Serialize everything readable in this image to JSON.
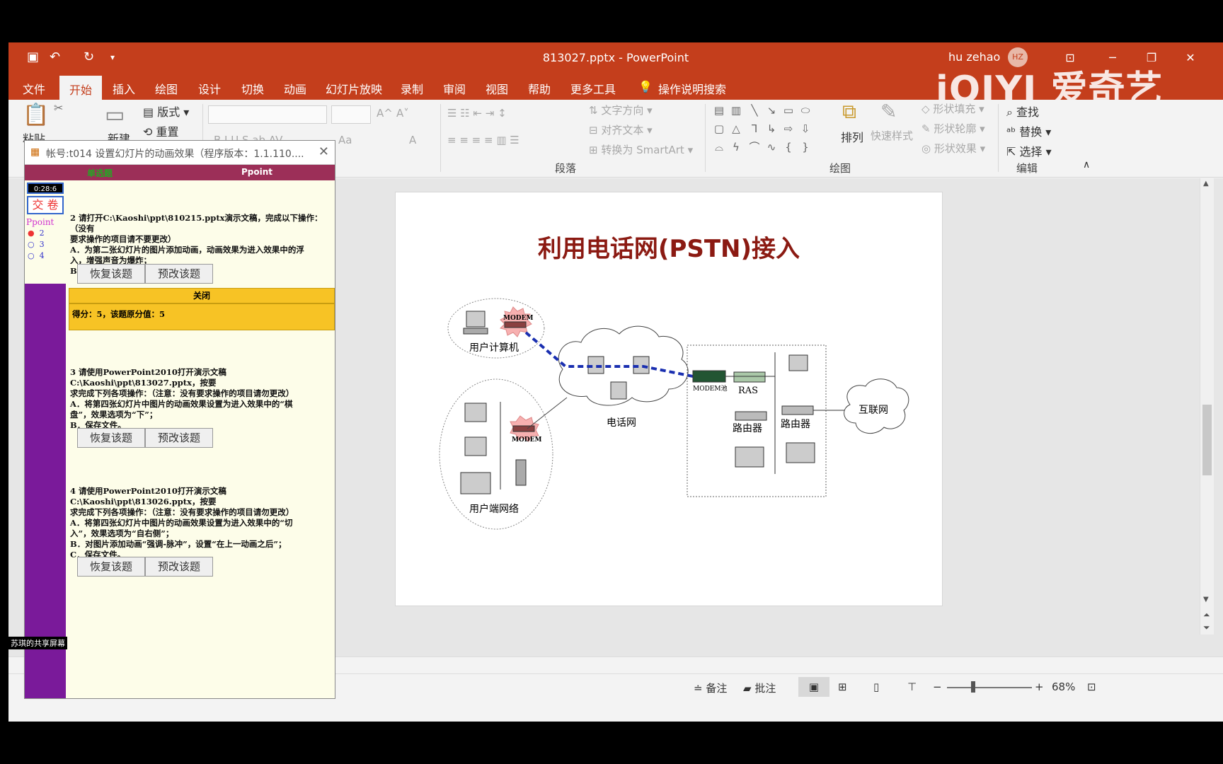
{
  "app": {
    "doc_title": "813027.pptx  -  PowerPoint",
    "user_name": "hu zehao",
    "user_initials": "HZ",
    "watermark": "iQIYI 爱奇艺"
  },
  "tabs": [
    "文件",
    "开始",
    "插入",
    "绘图",
    "设计",
    "切换",
    "动画",
    "幻灯片放映",
    "录制",
    "审阅",
    "视图",
    "帮助",
    "更多工具"
  ],
  "tell_me": "操作说明搜索",
  "ribbon": {
    "paste": "粘贴",
    "new_slide": "新建",
    "layout": "版式",
    "reset": "重置",
    "text_direction": "文字方向",
    "align_text": "对齐文本",
    "smartart": "转换为 SmartArt",
    "arrange": "排列",
    "quick_styles": "快速样式",
    "shape_fill": "形状填充",
    "shape_outline": "形状轮廓",
    "shape_effects": "形状效果",
    "find": "查找",
    "replace": "替换",
    "select": "选择",
    "group_paragraph": "段落",
    "group_drawing": "绘图",
    "group_editing": "编辑"
  },
  "slide": {
    "title": "利用电话网(PSTN)接入",
    "labels": {
      "user_pc": "用户计算机",
      "modem": "MODEM",
      "phone_net": "电话网",
      "modem_pool": "MODEM池",
      "ras": "RAS",
      "router1": "路由器",
      "router2": "路由器",
      "internet": "互联网",
      "user_lan": "用户端网络"
    }
  },
  "statusbar": {
    "notes": "备注",
    "comments": "批注",
    "zoom": "68%"
  },
  "exam": {
    "title": "帐号:t014  设置幻灯片的动画效果（程序版本：1.1.110....",
    "header_left": "单选题",
    "header_right": "Ppoint",
    "timer": "0:28:6",
    "submit": "交 卷",
    "ppoint": "Ppoint",
    "nav": [
      "2",
      "3",
      "4"
    ],
    "q2": {
      "lines": [
        "2  请打开C:\\Kaoshi\\ppt\\810215.pptx演示文稿，完成以下操作：（没有",
        "    要求操作的项目请不要更改）",
        "    A．为第二张幻灯片的图片添加动画，动画效果为进入效果中的浮",
        "    入，增强声音为爆炸；",
        "    B．保存文件。"
      ]
    },
    "btn_restore": "恢复该题",
    "btn_preview": "预改该题",
    "close_bar": "关闭",
    "score": "得分：5，该题原分值：5",
    "q3": {
      "lines": [
        "3  请使用PowerPoint2010打开演示文稿C:\\Kaoshi\\ppt\\813027.pptx，按要",
        "    求完成下列各项操作：（注意：没有要求操作的项目请勿更改）",
        "    A．将第四张幻灯片中图片的动画效果设置为进入效果中的“棋",
        "    盘”，效果选项为“下”；",
        "    B．保存文件。"
      ]
    },
    "q4": {
      "lines": [
        "4  请使用PowerPoint2010打开演示文稿C:\\Kaoshi\\ppt\\813026.pptx，按要",
        "    求完成下列各项操作：（注意：没有要求操作的项目请勿更改）",
        "    A．将第四张幻灯片中图片的动画效果设置为进入效果中的“切",
        "    入”，效果选项为“自右侧”；",
        "    B．对图片添加动画“强调-脉冲”，设置“在上一动画之后”；",
        "    C．保存文件。"
      ]
    },
    "share_label": "苏琪的共享屏幕"
  }
}
